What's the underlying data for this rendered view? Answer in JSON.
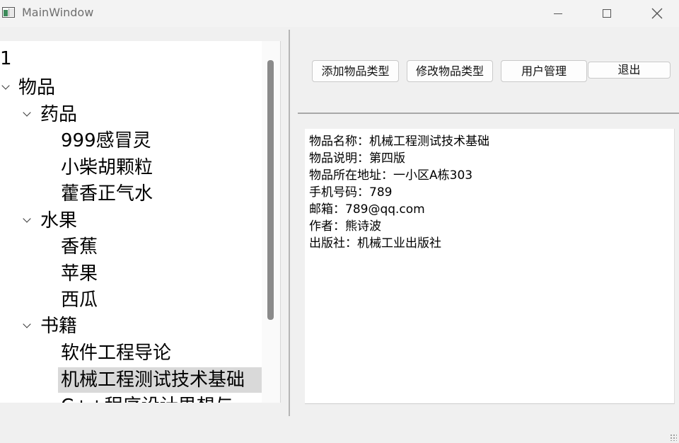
{
  "window": {
    "title": "MainWindow",
    "controls": {
      "minimize": "—",
      "maximize": "☐",
      "close": "✕"
    }
  },
  "tree": {
    "items": [
      {
        "label": "1",
        "level": 0,
        "expandable": false,
        "selected": false
      },
      {
        "label": "物品",
        "level": 0,
        "expandable": true,
        "selected": false
      },
      {
        "label": "药品",
        "level": 1,
        "expandable": true,
        "selected": false
      },
      {
        "label": "999感冒灵",
        "level": 2,
        "expandable": false,
        "selected": false
      },
      {
        "label": "小柴胡颗粒",
        "level": 2,
        "expandable": false,
        "selected": false
      },
      {
        "label": "藿香正气水",
        "level": 2,
        "expandable": false,
        "selected": false
      },
      {
        "label": "水果",
        "level": 1,
        "expandable": true,
        "selected": false
      },
      {
        "label": "香蕉",
        "level": 2,
        "expandable": false,
        "selected": false
      },
      {
        "label": "苹果",
        "level": 2,
        "expandable": false,
        "selected": false
      },
      {
        "label": "西瓜",
        "level": 2,
        "expandable": false,
        "selected": false
      },
      {
        "label": "书籍",
        "level": 1,
        "expandable": true,
        "selected": false
      },
      {
        "label": "软件工程导论",
        "level": 2,
        "expandable": false,
        "selected": false
      },
      {
        "label": "机械工程测试技术基础",
        "level": 2,
        "expandable": false,
        "selected": true
      },
      {
        "label": "C++程序设计思想与",
        "level": 2,
        "expandable": false,
        "selected": false
      }
    ]
  },
  "toolbar": {
    "add_type_label": "添加物品类型",
    "edit_type_label": "修改物品类型",
    "user_manage_label": "用户管理",
    "exit_label": "退出"
  },
  "detail": {
    "lines": [
      "物品名称：机械工程测试技术基础",
      "物品说明：第四版",
      "物品所在地址：一小区A栋303",
      "手机号码：789",
      "邮箱：789@qq.com",
      "作者：熊诗波",
      "出版社：机械工业出版社"
    ]
  }
}
